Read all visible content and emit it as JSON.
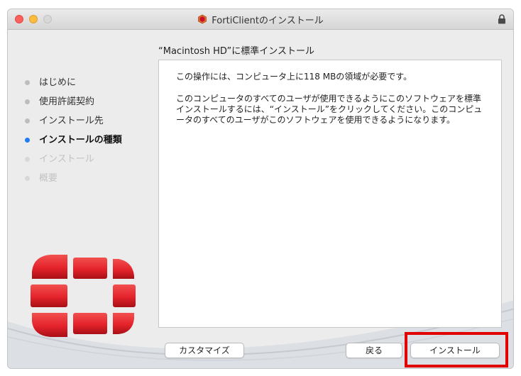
{
  "window": {
    "title": "FortiClientのインストール"
  },
  "header": {
    "subtitle": "“Macintosh HD”に標準インストール"
  },
  "sidebar": {
    "steps": [
      {
        "label": "はじめに",
        "state": "done"
      },
      {
        "label": "使用許諾契約",
        "state": "done"
      },
      {
        "label": "インストール先",
        "state": "done"
      },
      {
        "label": "インストールの種類",
        "state": "active"
      },
      {
        "label": "インストール",
        "state": "pending"
      },
      {
        "label": "概要",
        "state": "pending"
      }
    ]
  },
  "content": {
    "paragraph1": "この操作には、コンピュータ上に118 MBの領域が必要です。",
    "paragraph2": "このコンピュータのすべてのユーザが使用できるようにこのソフトウェアを標準インストールするには、“インストール”をクリックしてください。このコンピュータのすべてのユーザがこのソフトウェアを使用できるようになります。"
  },
  "buttons": {
    "customize": "カスタマイズ",
    "back": "戻る",
    "install": "インストール"
  },
  "colors": {
    "active_dot": "#1f7cf2",
    "highlight_box": "#e00000",
    "logo_red": "#e4232b"
  },
  "icons": {
    "app": "forticlient-app-icon",
    "lock": "lock-icon",
    "logo": "fortinet-logo"
  }
}
